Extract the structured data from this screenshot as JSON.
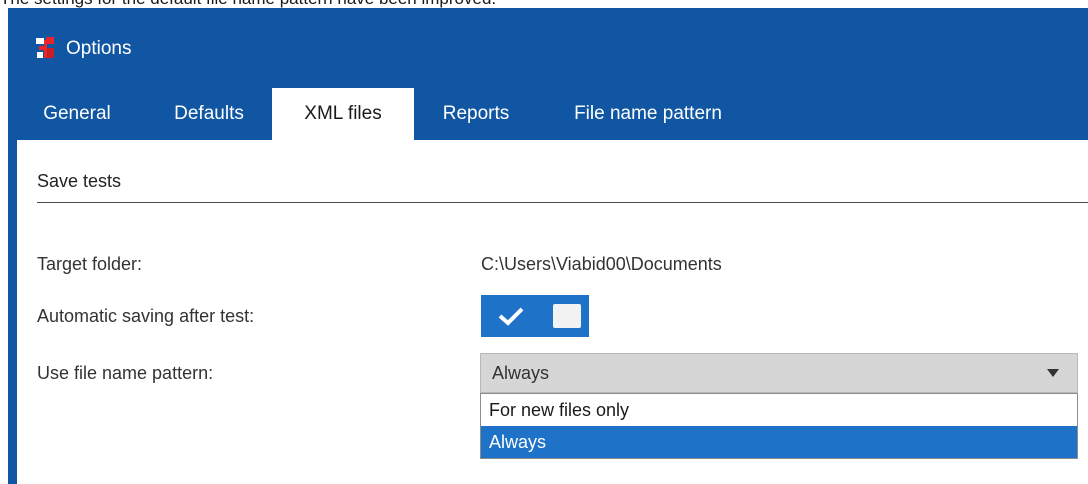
{
  "caption": "The settings for the default file name pattern have been improved.",
  "window": {
    "title": "Options",
    "icon": "app-logo-icon"
  },
  "tabs": [
    {
      "label": "General",
      "active": false
    },
    {
      "label": "Defaults",
      "active": false
    },
    {
      "label": "XML files",
      "active": true
    },
    {
      "label": "Reports",
      "active": false
    },
    {
      "label": "File name pattern",
      "active": false
    }
  ],
  "section": {
    "title": "Save tests"
  },
  "fields": {
    "target_folder": {
      "label": "Target folder:",
      "value": "C:\\Users\\Viabid00\\Documents"
    },
    "auto_save": {
      "label": "Automatic saving after test:",
      "checked": true,
      "icon": "check-icon"
    },
    "file_name_pattern": {
      "label": "Use file name pattern:",
      "selected": "Always",
      "arrow_icon": "dropdown-arrow-icon",
      "options": [
        "For new files only",
        "Always"
      ],
      "highlighted_index": 1
    }
  },
  "colors": {
    "window_bg": "#1156a3",
    "accent": "#1e73c8",
    "select_bg": "#d6d6d6"
  }
}
